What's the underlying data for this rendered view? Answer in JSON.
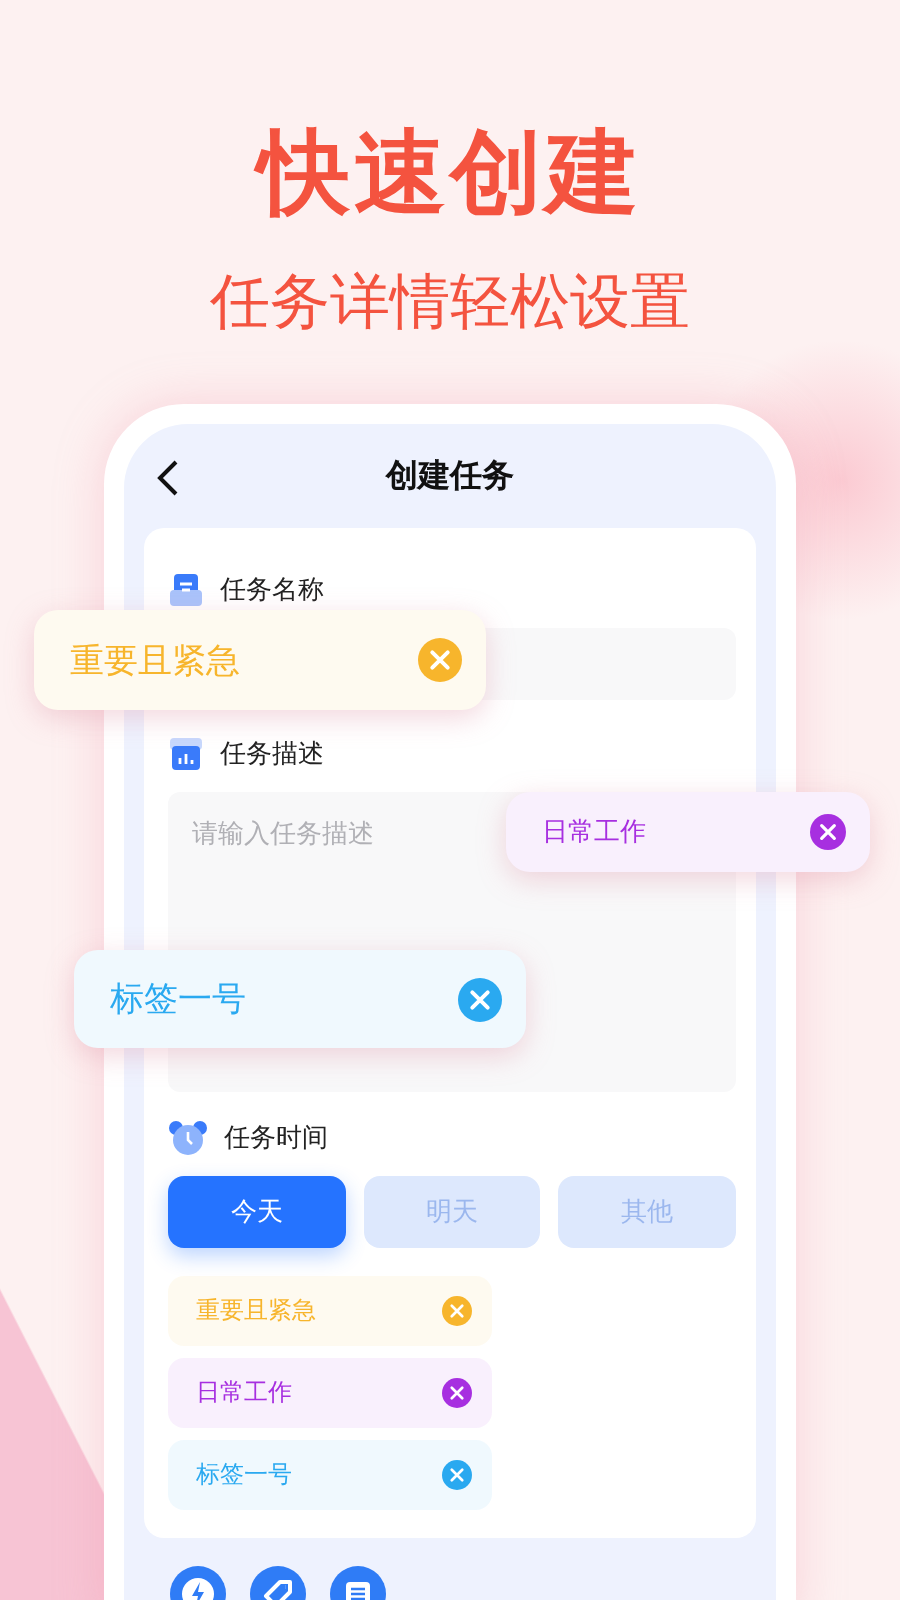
{
  "hero": {
    "title": "快速创建",
    "subtitle": "任务详情轻松设置"
  },
  "screen": {
    "title": "创建任务",
    "fields": [
      {
        "kind": "input",
        "label": "任务名称"
      },
      {
        "kind": "textarea",
        "label": "任务描述",
        "placeholder": "请输入任务描述"
      },
      {
        "kind": "time",
        "label": "任务时间"
      }
    ],
    "time_options": [
      {
        "label": "今天",
        "selected": true
      },
      {
        "label": "明天",
        "selected": false
      },
      {
        "label": "其他",
        "selected": false
      }
    ],
    "tags": [
      {
        "label": "重要且紧急",
        "color": "#f7b52c"
      },
      {
        "label": "日常工作",
        "color": "#a72fe0"
      },
      {
        "label": "标签一号",
        "color": "#2aa9f0"
      }
    ]
  },
  "floating_tags": [
    {
      "label": "重要且紧急",
      "color": "#f7b52c"
    },
    {
      "label": "日常工作",
      "color": "#a72fe0"
    },
    {
      "label": "标签一号",
      "color": "#2aa9f0"
    }
  ]
}
